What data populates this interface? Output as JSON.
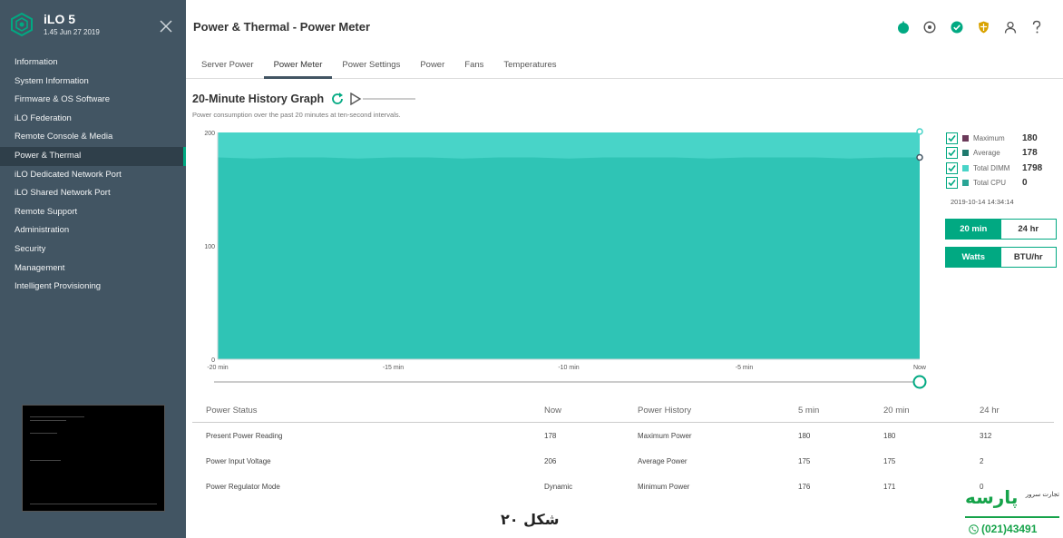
{
  "app": {
    "title": "iLO 5",
    "version": "1.45 Jun 27 2019"
  },
  "sidebar": {
    "items": [
      {
        "label": "Information"
      },
      {
        "label": "System Information"
      },
      {
        "label": "Firmware & OS Software"
      },
      {
        "label": "iLO Federation"
      },
      {
        "label": "Remote Console & Media"
      },
      {
        "label": "Power & Thermal",
        "active": true
      },
      {
        "label": "iLO Dedicated Network Port"
      },
      {
        "label": "iLO Shared Network Port"
      },
      {
        "label": "Remote Support"
      },
      {
        "label": "Administration"
      },
      {
        "label": "Security"
      },
      {
        "label": "Management"
      },
      {
        "label": "Intelligent Provisioning"
      }
    ]
  },
  "header": {
    "title": "Power & Thermal - Power Meter",
    "icons": [
      "power-status-icon",
      "uid-indicator-icon",
      "health-ok-icon",
      "security-shield-icon",
      "user-icon",
      "help-icon"
    ],
    "colors": {
      "power": "#01a982",
      "health": "#01a982",
      "shield": "#d9a300",
      "neutral": "#555555"
    }
  },
  "tabs": [
    {
      "label": "Server Power"
    },
    {
      "label": "Power Meter",
      "active": true
    },
    {
      "label": "Power Settings"
    },
    {
      "label": "Power"
    },
    {
      "label": "Fans"
    },
    {
      "label": "Temperatures"
    }
  ],
  "graph": {
    "title": "20-Minute History Graph",
    "subtitle": "Power consumption over the past 20 minutes at ten-second intervals."
  },
  "chart_data": {
    "type": "area",
    "xlabel": "",
    "ylabel": "",
    "ylim": [
      0,
      200
    ],
    "yticks": [
      "200",
      "100",
      "0"
    ],
    "xticks": [
      "-20 min",
      "-15 min",
      "-10 min",
      "-5 min",
      "Now"
    ],
    "series": [
      {
        "name": "Maximum",
        "color": "#48d4c8",
        "values_summary": "approximately 200 across the full 20 minutes"
      },
      {
        "name": "Average",
        "color": "#2fc4b5",
        "values": [
          178,
          177,
          178,
          178,
          177,
          178,
          178,
          177,
          178,
          178,
          177,
          178,
          178,
          178,
          177,
          178,
          178,
          178,
          177,
          178,
          178
        ]
      }
    ],
    "grid": false,
    "legend": "right"
  },
  "legend": {
    "items": [
      {
        "label": "Maximum",
        "value": "180",
        "color": "#6b3a5a",
        "checked": true
      },
      {
        "label": "Average",
        "value": "178",
        "color": "#1f7a6e",
        "checked": true
      },
      {
        "label": "Total DIMM",
        "value": "1798",
        "color": "#48d4c8",
        "checked": true
      },
      {
        "label": "Total CPU",
        "value": "0",
        "color": "#2aa596",
        "checked": true
      }
    ],
    "timestamp": "2019-10-14 14:34:14"
  },
  "range_toggle": {
    "options": [
      "20 min",
      "24 hr"
    ],
    "selected": "20 min"
  },
  "unit_toggle": {
    "options": [
      "Watts",
      "BTU/hr"
    ],
    "selected": "Watts"
  },
  "table": {
    "headers": [
      "Power Status",
      "Now",
      "Power History",
      "5 min",
      "20 min",
      "24 hr"
    ],
    "rows": [
      [
        "Present Power Reading",
        "178",
        "Maximum Power",
        "180",
        "180",
        "312"
      ],
      [
        "Power Input Voltage",
        "206",
        "Average Power",
        "175",
        "175",
        "2"
      ],
      [
        "Power Regulator Mode",
        "Dynamic",
        "Minimum Power",
        "176",
        "171",
        "0"
      ]
    ]
  },
  "overlay": {
    "caption": "شکل ۲۰",
    "brand": "پارسه",
    "tagline": "تجارت سرور",
    "phone": "(021)43491"
  }
}
